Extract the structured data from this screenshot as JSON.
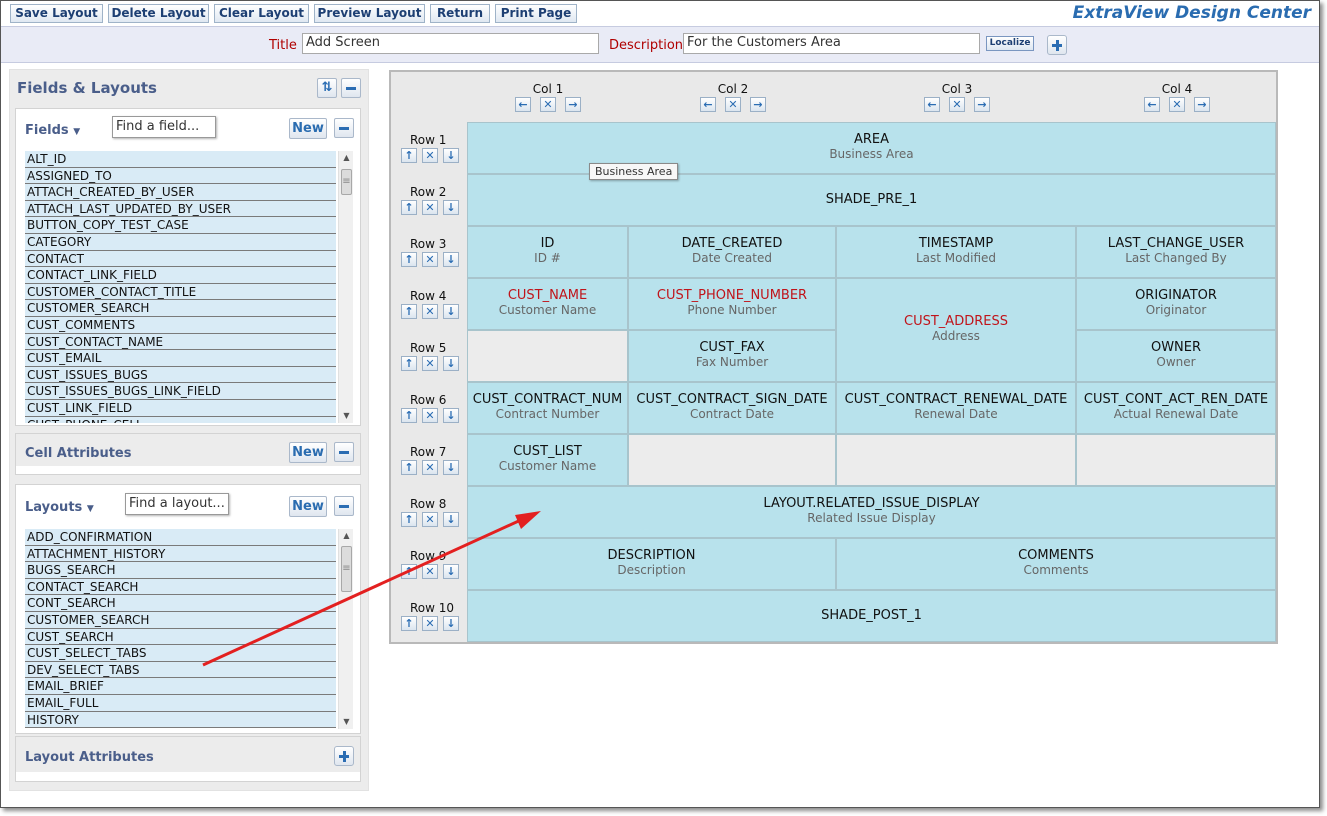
{
  "toolbar": {
    "buttons": [
      "Save Layout",
      "Delete Layout",
      "Clear Layout",
      "Preview Layout",
      "Return",
      "Print Page"
    ],
    "app_title": "ExtraView Design Center"
  },
  "titlebar": {
    "title_label": "Title",
    "title_value": "Add Screen",
    "description_label": "Description",
    "description_value": "For the Customers Area",
    "localize_label": "Localize"
  },
  "left": {
    "panel_title": "Fields & Layouts",
    "fields": {
      "title": "Fields",
      "search_placeholder": "Find a field...",
      "new_label": "New",
      "items": [
        "ALT_ID",
        "ASSIGNED_TO",
        "ATTACH_CREATED_BY_USER",
        "ATTACH_LAST_UPDATED_BY_USER",
        "BUTTON_COPY_TEST_CASE",
        "CATEGORY",
        "CONTACT",
        "CONTACT_LINK_FIELD",
        "CUSTOMER_CONTACT_TITLE",
        "CUSTOMER_SEARCH",
        "CUST_COMMENTS",
        "CUST_CONTACT_NAME",
        "CUST_EMAIL",
        "CUST_ISSUES_BUGS",
        "CUST_ISSUES_BUGS_LINK_FIELD",
        "CUST_LINK_FIELD",
        "CUST_PHONE_CELL"
      ]
    },
    "cell_attributes": {
      "title": "Cell Attributes",
      "new_label": "New"
    },
    "layouts": {
      "title": "Layouts",
      "search_placeholder": "Find a layout...",
      "new_label": "New",
      "items": [
        "ADD_CONFIRMATION",
        "ATTACHMENT_HISTORY",
        "BUGS_SEARCH",
        "CONTACT_SEARCH",
        "CONT_SEARCH",
        "CUSTOMER_SEARCH",
        "CUST_SEARCH",
        "CUST_SELECT_TABS",
        "DEV_SELECT_TABS",
        "EMAIL_BRIEF",
        "EMAIL_FULL",
        "HISTORY"
      ]
    },
    "layout_attributes": {
      "title": "Layout Attributes"
    }
  },
  "grid": {
    "cols": [
      "Col 1",
      "Col 2",
      "Col 3",
      "Col 4"
    ],
    "rows": [
      "Row 1",
      "Row 2",
      "Row 3",
      "Row 4",
      "Row 5",
      "Row 6",
      "Row 7",
      "Row 8",
      "Row 9",
      "Row 10"
    ],
    "cells": {
      "area": {
        "name": "AREA",
        "sub": "Business Area"
      },
      "shade_pre": {
        "name": "SHADE_PRE_1",
        "sub": ""
      },
      "id": {
        "name": "ID",
        "sub": "ID #"
      },
      "date_created": {
        "name": "DATE_CREATED",
        "sub": "Date Created"
      },
      "timestamp": {
        "name": "TIMESTAMP",
        "sub": "Last Modified"
      },
      "last_change_user": {
        "name": "LAST_CHANGE_USER",
        "sub": "Last Changed By"
      },
      "cust_name": {
        "name": "CUST_NAME",
        "sub": "Customer Name"
      },
      "cust_phone": {
        "name": "CUST_PHONE_NUMBER",
        "sub": "Phone Number"
      },
      "cust_address": {
        "name": "CUST_ADDRESS",
        "sub": "Address"
      },
      "originator": {
        "name": "ORIGINATOR",
        "sub": "Originator"
      },
      "cust_fax": {
        "name": "CUST_FAX",
        "sub": "Fax Number"
      },
      "owner": {
        "name": "OWNER",
        "sub": "Owner"
      },
      "contract_num": {
        "name": "CUST_CONTRACT_NUM",
        "sub": "Contract Number"
      },
      "contract_sign": {
        "name": "CUST_CONTRACT_SIGN_DATE",
        "sub": "Contract Date"
      },
      "contract_renewal": {
        "name": "CUST_CONTRACT_RENEWAL_DATE",
        "sub": "Renewal Date"
      },
      "cont_act_ren": {
        "name": "CUST_CONT_ACT_REN_DATE",
        "sub": "Actual Renewal Date"
      },
      "cust_list": {
        "name": "CUST_LIST",
        "sub": "Customer Name"
      },
      "related_issue": {
        "name": "LAYOUT.RELATED_ISSUE_DISPLAY",
        "sub": "Related Issue Display"
      },
      "description": {
        "name": "DESCRIPTION",
        "sub": "Description"
      },
      "comments": {
        "name": "COMMENTS",
        "sub": "Comments"
      },
      "shade_post": {
        "name": "SHADE_POST_1",
        "sub": ""
      }
    },
    "tooltip": "Business Area"
  },
  "colors": {
    "cell_bg": "#b8e2ec",
    "required_field": "#c0141a",
    "arrow": "#e32020",
    "title_accent": "#2a6cb0"
  }
}
